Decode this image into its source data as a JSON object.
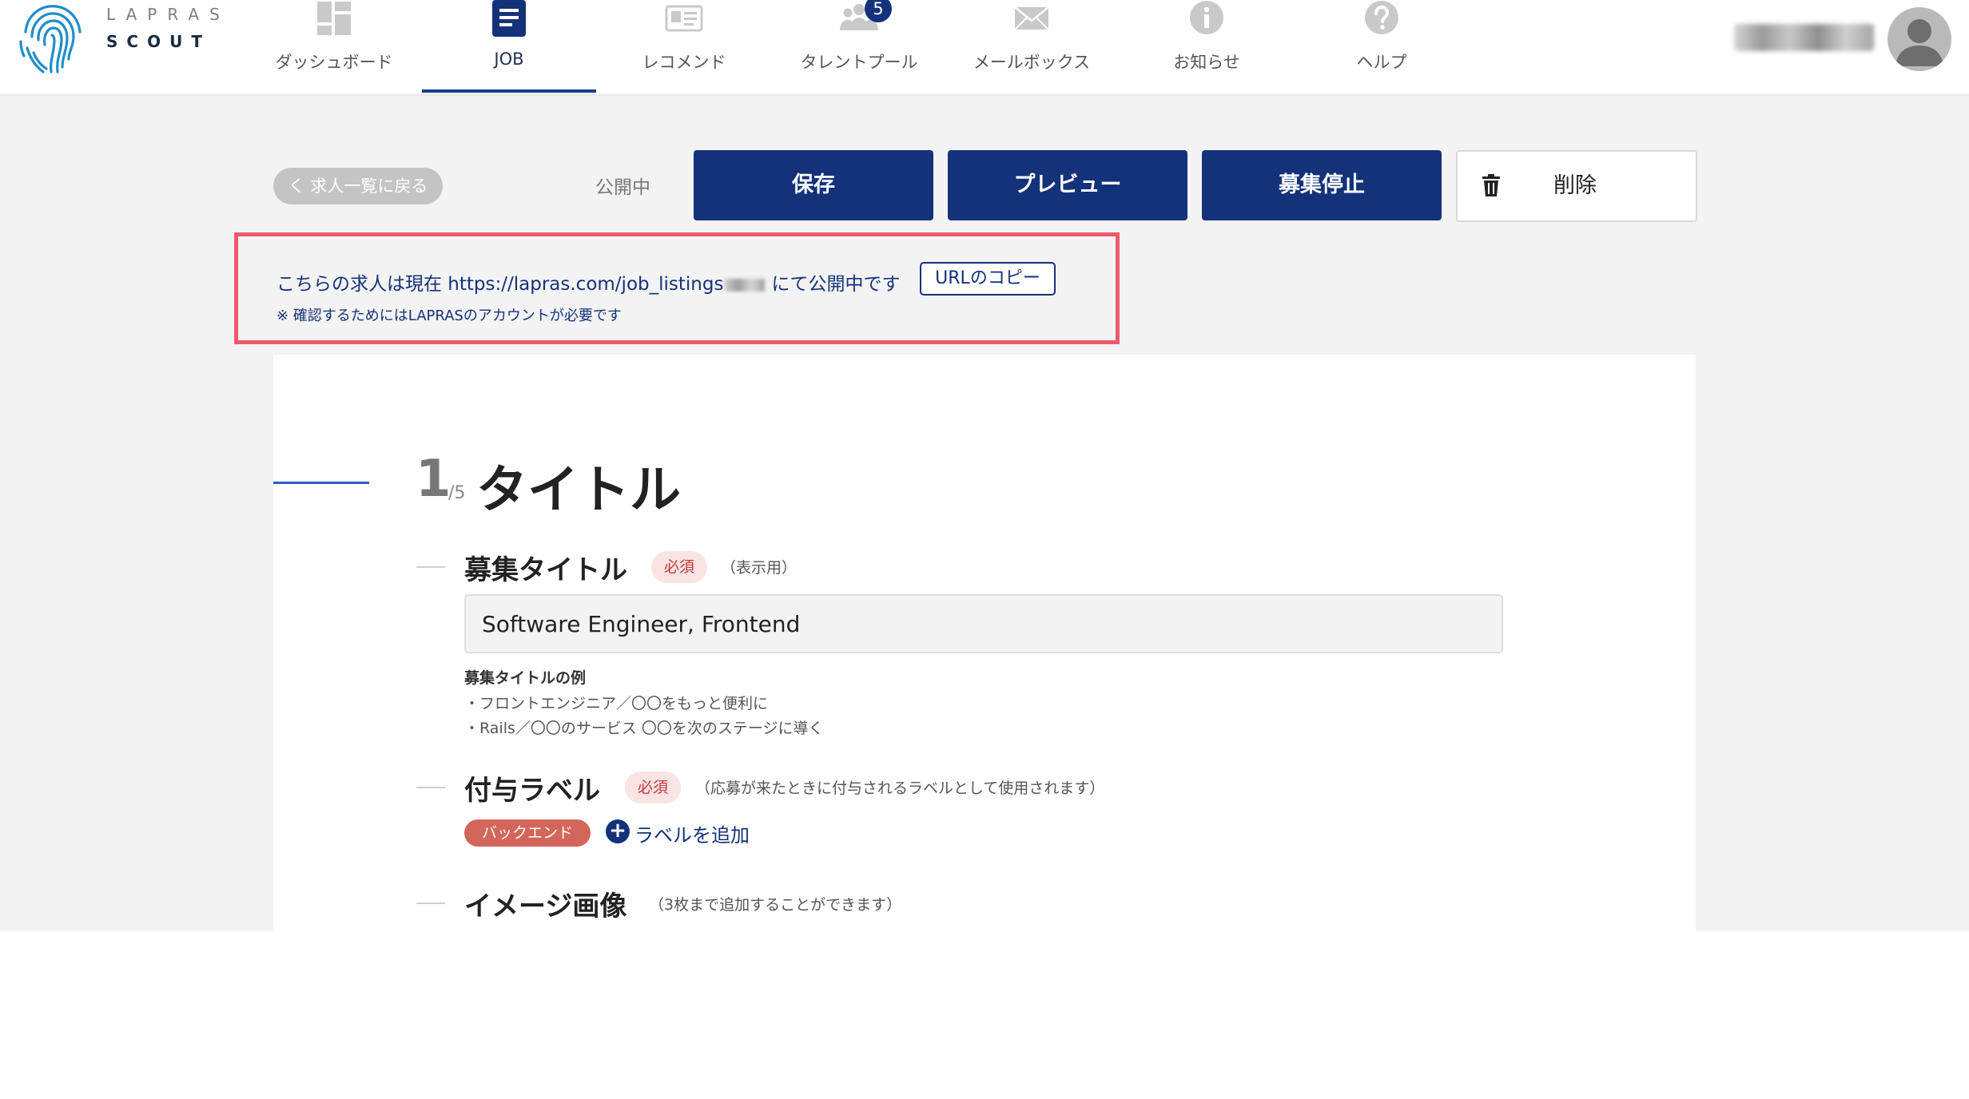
{
  "header": {
    "logo": {
      "line1": "LAPRAS",
      "line2": "SCOUT"
    },
    "nav": [
      {
        "label": "ダッシュボード",
        "icon": "dashboard-icon",
        "active": false
      },
      {
        "label": "JOB",
        "icon": "document-icon",
        "active": true
      },
      {
        "label": "レコメンド",
        "icon": "id-card-icon",
        "active": false
      },
      {
        "label": "タレントプール",
        "icon": "people-icon",
        "active": false,
        "badge": "5"
      },
      {
        "label": "メールボックス",
        "icon": "envelope-icon",
        "active": false
      },
      {
        "label": "お知らせ",
        "icon": "info-icon",
        "active": false
      },
      {
        "label": "ヘルプ",
        "icon": "help-icon",
        "active": false
      }
    ]
  },
  "toolbar": {
    "back_label": "く 求人一覧に戻る",
    "status": "公開中",
    "save_label": "保存",
    "preview_label": "プレビュー",
    "stop_label": "募集停止",
    "delete_label": "削除"
  },
  "notice": {
    "text_prefix": "こちらの求人は現在 https://lapras.com/job_listings",
    "text_suffix": "にて公開中です",
    "copy_label": "URLのコピー",
    "sub_note": "※ 確認するためにはLAPRASのアカウントが必要です"
  },
  "form": {
    "section_number": "1",
    "section_total": "/5",
    "section_title": "タイトル",
    "title_field": {
      "label": "募集タイトル",
      "required": "必須",
      "note": "（表示用）",
      "value": "Software Engineer, Frontend",
      "example_heading": "募集タイトルの例",
      "examples": [
        "・フロントエンジニア／〇〇をもっと便利に",
        "・Rails／〇〇のサービス 〇〇を次のステージに導く"
      ]
    },
    "label_field": {
      "label": "付与ラベル",
      "required": "必須",
      "note": "（応募が来たときに付与されるラベルとして使用されます）",
      "tags": [
        "バックエンド"
      ],
      "add_label": "ラベルを追加"
    },
    "image_field": {
      "label": "イメージ画像",
      "note": "（3枚まで追加することができます）"
    }
  },
  "colors": {
    "primary": "#14327a",
    "notice_border": "#ec5a6b",
    "tag": "#d2665a",
    "required_bg": "#f9e3e3",
    "required_text": "#c73838"
  }
}
